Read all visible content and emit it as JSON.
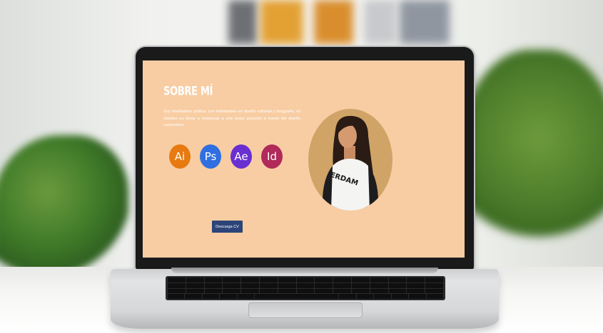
{
  "page": {
    "section_title": "SOBRE MÍ",
    "about_text": "Soy diseñadora gráfica, con habilidades en diseño editorial y fotografía, mi objetivo es llevar a empresas a una mejor posición a través del diseño corporativo.",
    "skills": [
      {
        "label": "Ai",
        "color": "#e77a10"
      },
      {
        "label": "Ps",
        "color": "#2f6fe0"
      },
      {
        "label": "Ae",
        "color": "#6a2fd1"
      },
      {
        "label": "Id",
        "color": "#b02a5a"
      }
    ],
    "cv_button": "Descarga CV",
    "portrait_shirt_text": "ERDAM"
  },
  "colors": {
    "page_background": "#f8cda3",
    "portrait_background": "#d0a467",
    "button": "#2c4478"
  }
}
